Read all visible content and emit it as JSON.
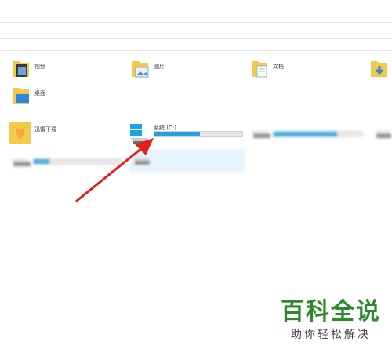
{
  "folders": [
    {
      "label": "视频",
      "icon": "video-folder-icon"
    },
    {
      "label": "图片",
      "icon": "pictures-folder-icon"
    },
    {
      "label": "文档",
      "icon": "documents-folder-icon"
    },
    {
      "label": "",
      "icon": "downloads-folder-icon"
    },
    {
      "label": "桌面",
      "icon": "desktop-folder-icon"
    }
  ],
  "devices": [
    {
      "label": "迅雷下载",
      "icon": "xunlei-download-icon"
    },
    {
      "label": "系统 (C:)",
      "icon": "windows-drive-icon",
      "usage_fraction": 0.52
    },
    {
      "label": "",
      "icon": "drive-icon",
      "usage_fraction": 0.72
    },
    {
      "label": "",
      "icon": "drive-icon",
      "usage_fraction": 0.18
    },
    {
      "label": "",
      "icon": "dvd-drive-icon"
    }
  ],
  "colors": {
    "accent": "#26a0da",
    "arrow": "#e02020",
    "brand": "#2c8a2c"
  },
  "watermark": {
    "title": "百科全说",
    "subtitle": "助你轻松解决"
  }
}
